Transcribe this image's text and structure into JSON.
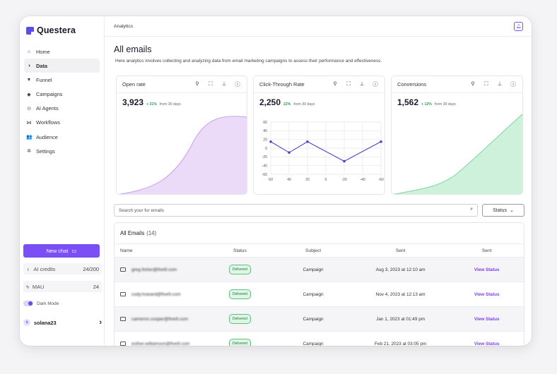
{
  "app": {
    "name": "Questera"
  },
  "sidebar": {
    "items": [
      {
        "label": "Home",
        "icon": "home-icon",
        "glyph": "⌂"
      },
      {
        "label": "Data",
        "icon": "data-icon",
        "glyph": "◑"
      },
      {
        "label": "Funnel",
        "icon": "funnel-icon",
        "glyph": "▼"
      },
      {
        "label": "Campaigns",
        "icon": "campaigns-icon",
        "glyph": "◆"
      },
      {
        "label": "AI Agents",
        "icon": "ai-agents-icon",
        "glyph": "⊙"
      },
      {
        "label": "Workflows",
        "icon": "workflows-icon",
        "glyph": "⋈"
      },
      {
        "label": "Audience",
        "icon": "audience-icon",
        "glyph": "👥"
      },
      {
        "label": "Settings",
        "icon": "settings-icon",
        "glyph": "✲"
      }
    ],
    "new_chat": "New chat",
    "ai_credits_label": "AI credits",
    "ai_credits_value": "24/200",
    "mau_label": "MAU",
    "mau_value": "24",
    "dark_mode_label": "Dark Mode",
    "user": {
      "initial": "s",
      "name": "solana23"
    }
  },
  "topbar": {
    "breadcrumb": "Analytics"
  },
  "page": {
    "title": "All emails",
    "description": "Here analytics involves collecting and analyzing data from email marketing campaigns to assess their performance and effectiveness."
  },
  "cards": {
    "open_rate": {
      "title": "Open rate",
      "value": "3,923",
      "change": "+ 31%",
      "from": "from 30 days",
      "color": "#e7d3f7"
    },
    "ctr": {
      "title": "Click-Through Rate",
      "value": "2,250",
      "change": "22%",
      "from": "from 30 days"
    },
    "conversions": {
      "title": "Conversions",
      "value": "1,562",
      "change": "+ 12%",
      "from": "from 30 days",
      "color": "#c6efd4"
    }
  },
  "chart_data": {
    "type": "line",
    "x": [
      60,
      40,
      20,
      0,
      -20,
      -40,
      -60
    ],
    "values": [
      15,
      -10,
      15,
      null,
      -30,
      null,
      15
    ],
    "points": [
      {
        "x": 60,
        "y": 15
      },
      {
        "x": 40,
        "y": -10
      },
      {
        "x": 20,
        "y": 15
      },
      {
        "x": -20,
        "y": -30
      },
      {
        "x": -60,
        "y": 15
      }
    ],
    "ylim": [
      -60,
      60
    ],
    "xticks": [
      "60",
      "40",
      "20",
      "0",
      "-20",
      "-40",
      "-60"
    ],
    "yticks": [
      "60",
      "40",
      "20",
      "0",
      "-20",
      "-40",
      "-60"
    ],
    "grid": true,
    "color": "#5a3bc4"
  },
  "search": {
    "placeholder": "Search your for emails"
  },
  "status_filter": "Status",
  "table": {
    "title": "All Emails",
    "count": "(14)",
    "headers": [
      "Name",
      "Status",
      "Subject",
      "Sent",
      "Sent"
    ],
    "rows": [
      {
        "name": "greg.fisher@five9.com",
        "status": "Delivered",
        "subject": "Campaign",
        "sent": "Aug 3, 2023 at 12:10 am",
        "link": "View Status"
      },
      {
        "name": "cody.howard@five9.com",
        "status": "Delivered",
        "subject": "Campaign",
        "sent": "Nov 4, 2023 at 12:13 am",
        "link": "View Status"
      },
      {
        "name": "cameron.cooper@five9.com",
        "status": "Delivered",
        "subject": "Campaign",
        "sent": "Jan 1, 2023 at 01:49 pm",
        "link": "View Status"
      },
      {
        "name": "esther.williamson@five9.com",
        "status": "Delivered",
        "subject": "Campaign",
        "sent": "Feb 21, 2023 at 03:05 pm",
        "link": "View Status"
      }
    ]
  }
}
